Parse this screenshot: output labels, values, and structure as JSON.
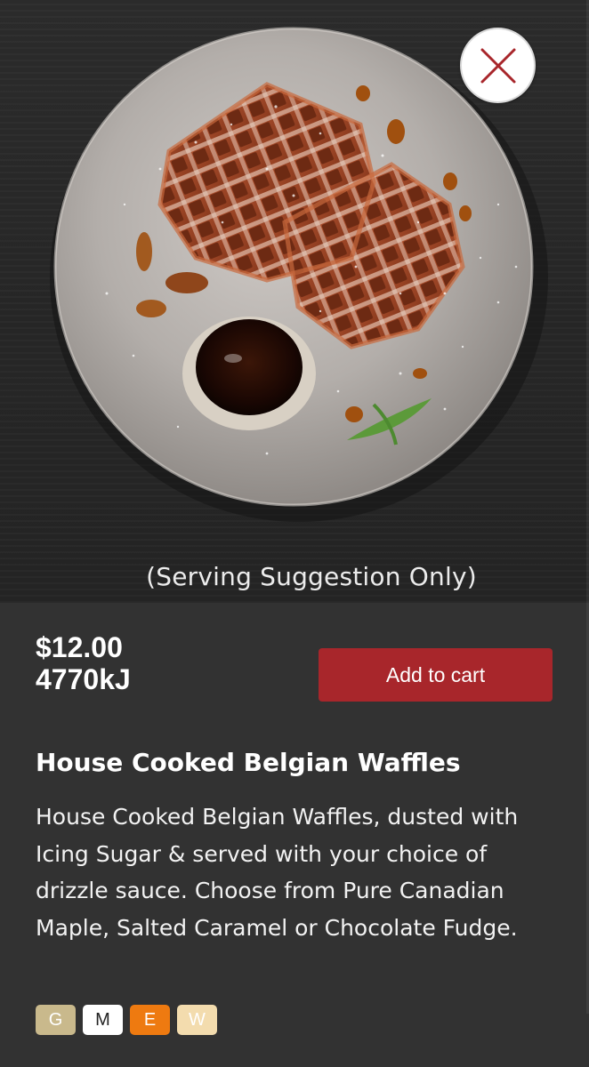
{
  "hero": {
    "image_description_icon": "waffle-plate-photo",
    "caption": "(Serving Suggestion Only)",
    "close_icon": "close-icon"
  },
  "product": {
    "price": "$12.00",
    "energy": "4770kJ",
    "add_to_cart_label": "Add to cart",
    "title": "House Cooked Belgian Waffles",
    "description": "House Cooked Belgian Waffles, dusted with Icing Sugar & served with your choice of drizzle sauce. Choose from Pure Canadian Maple, Salted Caramel or Chocolate Fudge."
  },
  "badges": [
    {
      "letter": "G",
      "bg": "#c9b98c",
      "fg": "#ffffff"
    },
    {
      "letter": "M",
      "bg": "#ffffff",
      "fg": "#222222"
    },
    {
      "letter": "E",
      "bg": "#ee7a10",
      "fg": "#ffffff"
    },
    {
      "letter": "W",
      "bg": "#f3dcae",
      "fg": "#ffffff"
    }
  ],
  "colors": {
    "background": "#323232",
    "accent_button": "#a8262b",
    "close_ring": "#a8262b"
  }
}
